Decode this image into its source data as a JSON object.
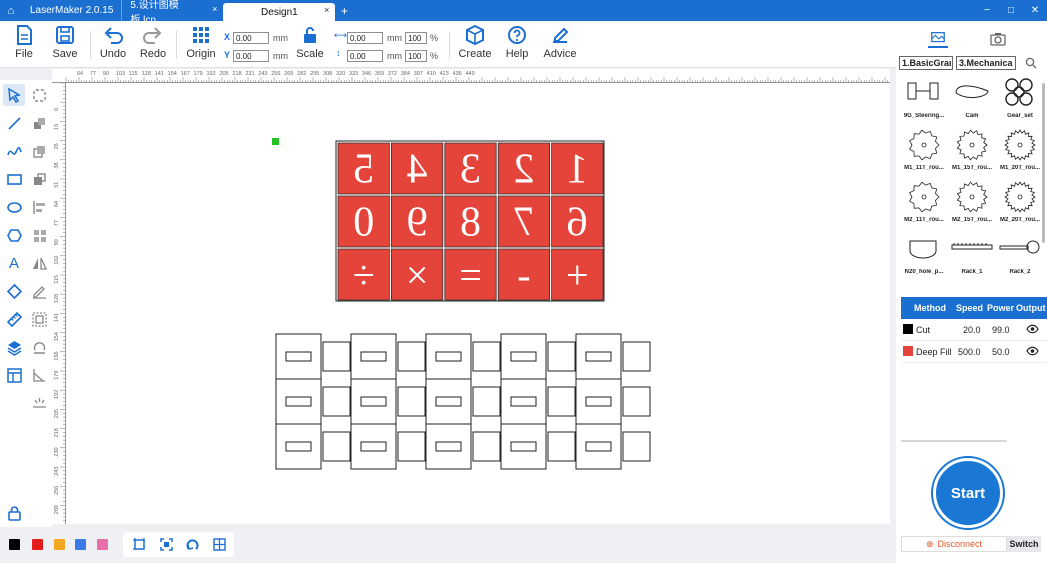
{
  "titlebar": {
    "app": "LaserMaker 2.0.15",
    "tabs": [
      {
        "label": "5.设计图模板.lcp"
      },
      {
        "label": "Design1"
      }
    ],
    "close_glyph": "×",
    "add_glyph": "+",
    "win_min": "−",
    "win_max": "□",
    "win_close": "✕"
  },
  "toolbar": {
    "file": "File",
    "save": "Save",
    "undo": "Undo",
    "redo": "Redo",
    "origin": "Origin",
    "x_label": "X",
    "y_label": "Y",
    "x_value": "0.00",
    "y_value": "0.00",
    "unit": "mm",
    "scale": "Scale",
    "w_value": "0.00",
    "h_value": "0.00",
    "w_pct": "100",
    "h_pct": "100",
    "pct": "%",
    "create": "Create",
    "help": "Help",
    "advice": "Advice"
  },
  "ruler": {
    "unit": "mm",
    "h_ticks": [
      "64",
      "77",
      "90",
      "103",
      "115",
      "128",
      "141",
      "154",
      "167",
      "179",
      "192",
      "205",
      "218",
      "231",
      "243",
      "256",
      "269",
      "282",
      "295",
      "308",
      "320",
      "333",
      "346",
      "359",
      "372",
      "384",
      "397",
      "410",
      "423",
      "436",
      "449"
    ],
    "v_ticks": [
      "0",
      "13",
      "26",
      "38",
      "51",
      "64",
      "77",
      "90",
      "102",
      "115",
      "128",
      "141",
      "154",
      "166",
      "179",
      "192",
      "205",
      "218",
      "230",
      "243",
      "256",
      "269",
      "282"
    ]
  },
  "design": {
    "digits_row1": [
      "5",
      "4",
      "3",
      "2",
      "1"
    ],
    "digits_row2": [
      "0",
      "9",
      "8",
      "7",
      "6"
    ],
    "ops_row3": [
      "÷",
      "×",
      "=",
      "-",
      "+"
    ]
  },
  "colors": {
    "accent": "#1b6fd1",
    "fill_red": "#e5443a",
    "palette": [
      "#000000",
      "#e51c1c",
      "#f5a623",
      "#3b7be8",
      "#e86ea9"
    ]
  },
  "library": {
    "category1": "1.BasicGraı",
    "category2": "3.Mechanica",
    "items": [
      "9G_Steering...",
      "Cam",
      "Gear_set",
      "M1_11T_rou...",
      "M1_15T_rou...",
      "M1_20T_rou...",
      "M2_11T_rou...",
      "M2_15T_rou...",
      "M2_20T_rou...",
      "N20_hole_p...",
      "Rack_1",
      "Rack_2"
    ]
  },
  "layers": {
    "headers": [
      "Method",
      "Speed",
      "Power",
      "Output"
    ],
    "rows": [
      {
        "method": "Cut",
        "speed": "20.0",
        "power": "99.0",
        "color": "#000000"
      },
      {
        "method": "Deep Fill",
        "speed": "500.0",
        "power": "50.0",
        "color": "#e5443a"
      }
    ]
  },
  "device": {
    "start": "Start",
    "disconnect": "Disconnect",
    "switch": "Switch"
  }
}
